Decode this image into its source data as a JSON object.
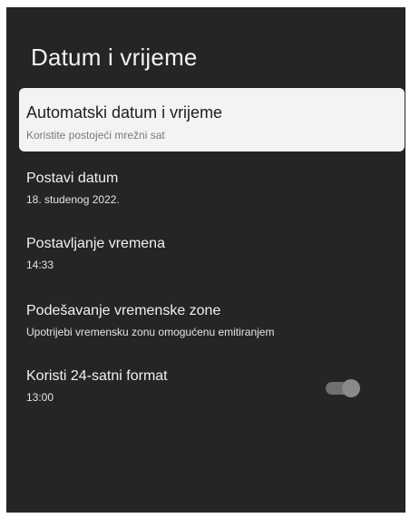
{
  "screen": {
    "title": "Datum i vrijeme"
  },
  "settings": {
    "automatic": {
      "title": "Automatski datum i vrijeme",
      "subtitle": "Koristite postojeći mrežni sat"
    },
    "set_date": {
      "title": "Postavi datum",
      "value": "18. studenog 2022."
    },
    "set_time": {
      "title": "Postavljanje vremena",
      "value": "14:33"
    },
    "time_zone": {
      "title": "Podešavanje vremenske zone",
      "value": "Upotrijebi vremensku zonu omogućenu emitiranjem"
    },
    "format_24h": {
      "title": "Koristi 24-satni format",
      "value": "13:00",
      "toggle_on": true
    }
  },
  "colors": {
    "background": "#252525",
    "focused_item": "#f3f3f3",
    "toggle_track": "#6f6f6f",
    "toggle_knob": "#8a8a8a"
  }
}
